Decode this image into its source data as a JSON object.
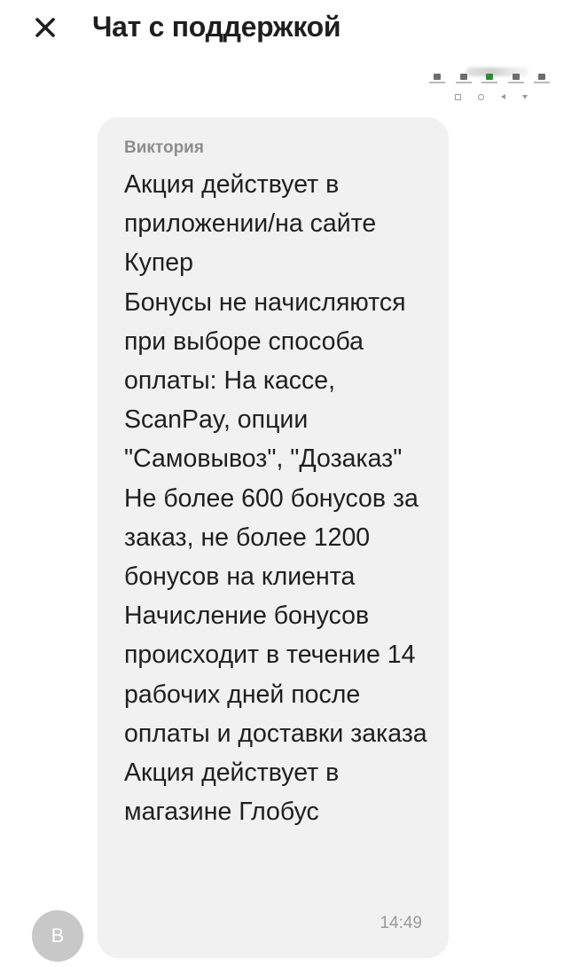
{
  "header": {
    "title": "Чат с поддержкой",
    "close_icon": "close-icon"
  },
  "attachment": {
    "kind": "screenshot-thumbnail"
  },
  "message": {
    "sender": "Виктория",
    "text": "Акция действует в приложении/на сайте Купер\nБонусы не начисляются при выборе способа оплаты: На кассе, ScanPay, опции \"Самовывоз\", \"Дозаказ\"\nНе более 600 бонусов за заказ, не более 1200 бонусов на клиента\nНачисление бонусов происходит в течение 14 рабочих дней после оплаты и доставки заказа\nАкция действует в магазине Глобус",
    "time": "14:49",
    "avatar_letter": "В"
  },
  "colors": {
    "bubble_bg": "#f1f1f1",
    "avatar_bg": "#c8c8c8",
    "text": "#1f1f1f",
    "meta": "#9a9a9a"
  }
}
